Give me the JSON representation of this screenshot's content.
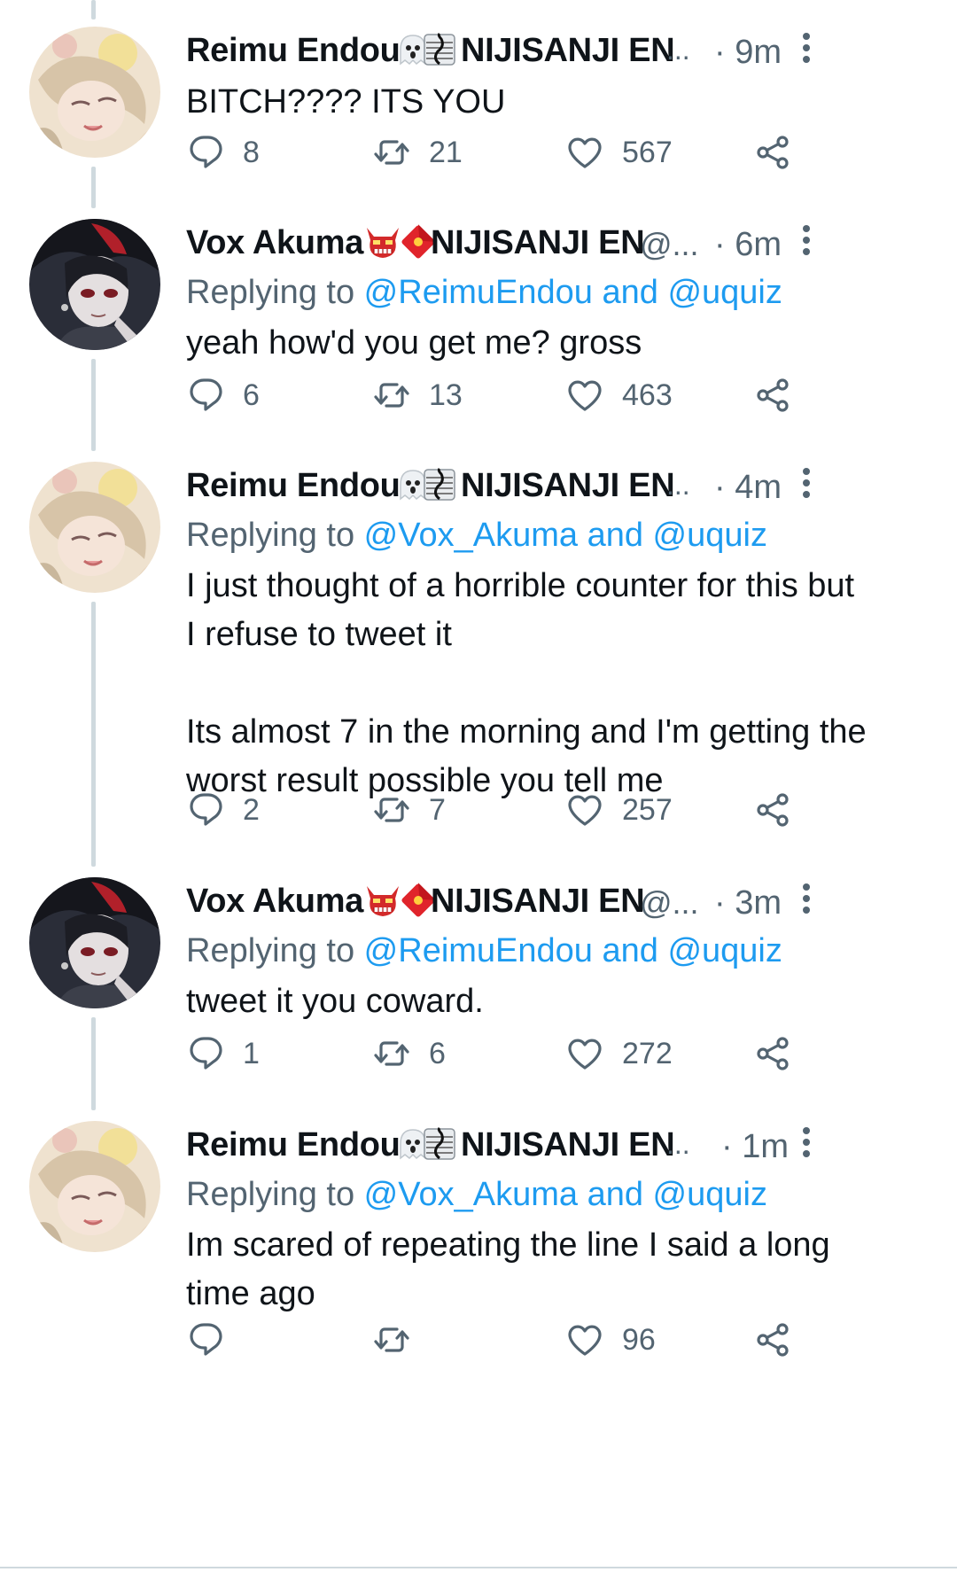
{
  "thread": [
    {
      "author": "Reimu Endou",
      "org": "NIJISANJI EN",
      "handle": "",
      "time": "· 9m",
      "reply_prefix": "",
      "reply_mentions": "",
      "text": "BITCH???? ITS YOU",
      "replies": "8",
      "retweets": "21",
      "likes": "567"
    },
    {
      "author": "Vox Akuma",
      "org": "NIJISANJI EN",
      "handle": "@...",
      "time": "· 6m",
      "reply_prefix": "Replying to ",
      "reply_mentions": "@ReimuEndou and @uquiz",
      "text": "yeah how'd you get me? gross",
      "replies": "6",
      "retweets": "13",
      "likes": "463"
    },
    {
      "author": "Reimu Endou",
      "org": "NIJISANJI EN",
      "handle": "",
      "time": "· 4m",
      "reply_prefix": "Replying to ",
      "reply_mentions": "@Vox_Akuma and @uquiz",
      "text": "I just thought of a horrible counter for this but\nI refuse to tweet it\n\nIts almost 7 in the morning and I'm getting the\nworst result possible you tell me",
      "replies": "2",
      "retweets": "7",
      "likes": "257"
    },
    {
      "author": "Vox Akuma",
      "org": "NIJISANJI EN",
      "handle": "@...",
      "time": "· 3m",
      "reply_prefix": "Replying to ",
      "reply_mentions": "@ReimuEndou and @uquiz",
      "text": "tweet it you coward.",
      "replies": "1",
      "retweets": "6",
      "likes": "272"
    },
    {
      "author": "Reimu Endou",
      "org": "NIJISANJI EN",
      "handle": "",
      "time": "· 1m",
      "reply_prefix": "Replying to ",
      "reply_mentions": "@Vox_Akuma and @uquiz",
      "text": "Im scared of repeating the line I said a long\ntime ago",
      "replies": "",
      "retweets": "",
      "likes": "96"
    }
  ],
  "truncation_marker": "...",
  "icons": {
    "reply": "reply-icon",
    "retweet": "retweet-icon",
    "like": "heart-icon",
    "share": "share-icon",
    "more": "more-vertical-icon",
    "reimu_badges": [
      "ghost-emoji",
      "musical-score-emoji"
    ],
    "vox_badges": [
      "ogre-emoji",
      "red-envelope-emoji"
    ]
  },
  "colors": {
    "text": "#0f1419",
    "secondary": "#536471",
    "link": "#1d9bf0",
    "thread_line": "#cfd9de"
  }
}
